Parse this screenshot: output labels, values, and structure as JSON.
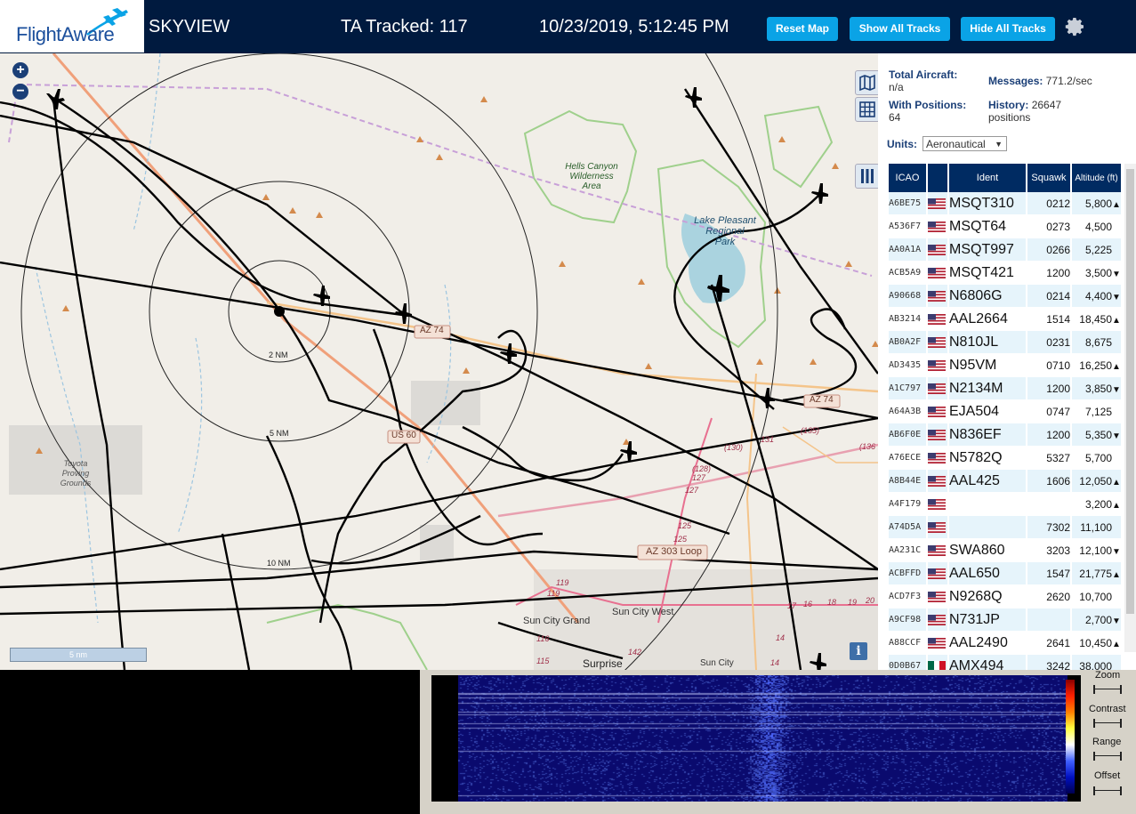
{
  "header": {
    "logo_text": "FlightAware",
    "app_name": "SKYVIEW",
    "tracked": "TA Tracked: 117",
    "datetime": "10/23/2019, 5:12:45 PM",
    "btn_reset": "Reset Map",
    "btn_show": "Show All Tracks",
    "btn_hide": "Hide All Tracks",
    "gear_icon": "gear-icon"
  },
  "map": {
    "zoom_in": "+",
    "zoom_out": "−",
    "labels": {
      "hells": [
        "Hells Canyon",
        "Wilderness",
        "Area"
      ],
      "lake": [
        "Lake Pleasant",
        "Regional",
        "Park"
      ],
      "toyota": [
        "Toyota",
        "Proving",
        "Grounds"
      ],
      "az74": "AZ 74",
      "az74b": "AZ 74",
      "us60": "US 60",
      "az303": "AZ 303 Loop",
      "suncitygrand": "Sun City Grand",
      "suncitywest": "Sun City West",
      "surprise": "Surprise",
      "suncity": "Sun City",
      "r2": "2 NM",
      "r5": "5 NM",
      "r10": "10 NM",
      "n131": "131",
      "n135": "(135)",
      "n130": "(130)",
      "n128": "(128)",
      "n127a": "127",
      "n127b": "127",
      "n136": "(136",
      "n125a": "125",
      "n125b": "125",
      "n119a": "119",
      "n119b": "119",
      "n116": "116",
      "n115": "115",
      "n142": "142",
      "n14a": "14",
      "n14b": "14",
      "n17": "17",
      "n16": "16",
      "n18": "18",
      "n19": "19",
      "n20": "20"
    },
    "scale": "5 nm",
    "info": "i"
  },
  "panel": {
    "total_label": "Total Aircraft:",
    "total_value": "n/a",
    "positions_label": "With Positions:",
    "positions_value": "64",
    "messages_label": "Messages:",
    "messages_value": "771.2/sec",
    "history_label": "History:",
    "history_value": "26647",
    "history_unit": "positions",
    "units_label": "Units:",
    "units_value": "Aeronautical",
    "columns": [
      "ICAO",
      "",
      "Ident",
      "Squawk",
      "Altitude (ft)"
    ]
  },
  "aircraft": [
    {
      "icao": "A6BE75",
      "flag": "us",
      "ident": "MSQT310",
      "squawk": "0212",
      "alt": "5,800",
      "trend": "▲"
    },
    {
      "icao": "A536F7",
      "flag": "us",
      "ident": "MSQT64",
      "squawk": "0273",
      "alt": "4,500",
      "trend": ""
    },
    {
      "icao": "AA0A1A",
      "flag": "us",
      "ident": "MSQT997",
      "squawk": "0266",
      "alt": "5,225",
      "trend": ""
    },
    {
      "icao": "ACB5A9",
      "flag": "us",
      "ident": "MSQT421",
      "squawk": "1200",
      "alt": "3,500",
      "trend": "▼"
    },
    {
      "icao": "A90668",
      "flag": "us",
      "ident": "N6806G",
      "squawk": "0214",
      "alt": "4,400",
      "trend": "▼"
    },
    {
      "icao": "AB3214",
      "flag": "us",
      "ident": "AAL2664",
      "squawk": "1514",
      "alt": "18,450",
      "trend": "▲"
    },
    {
      "icao": "AB0A2F",
      "flag": "us",
      "ident": "N810JL",
      "squawk": "0231",
      "alt": "8,675",
      "trend": ""
    },
    {
      "icao": "AD3435",
      "flag": "us",
      "ident": "N95VM",
      "squawk": "0710",
      "alt": "16,250",
      "trend": "▲"
    },
    {
      "icao": "A1C797",
      "flag": "us",
      "ident": "N2134M",
      "squawk": "1200",
      "alt": "3,850",
      "trend": "▼"
    },
    {
      "icao": "A64A3B",
      "flag": "us",
      "ident": "EJA504",
      "squawk": "0747",
      "alt": "7,125",
      "trend": ""
    },
    {
      "icao": "AB6F0E",
      "flag": "us",
      "ident": "N836EF",
      "squawk": "1200",
      "alt": "5,350",
      "trend": "▼"
    },
    {
      "icao": "A76ECE",
      "flag": "us",
      "ident": "N5782Q",
      "squawk": "5327",
      "alt": "5,700",
      "trend": ""
    },
    {
      "icao": "A8B44E",
      "flag": "us",
      "ident": "AAL425",
      "squawk": "1606",
      "alt": "12,050",
      "trend": "▲"
    },
    {
      "icao": "A4F179",
      "flag": "us",
      "ident": "",
      "squawk": "",
      "alt": "3,200",
      "trend": "▲"
    },
    {
      "icao": "A74D5A",
      "flag": "us",
      "ident": "",
      "squawk": "7302",
      "alt": "11,100",
      "trend": ""
    },
    {
      "icao": "AA231C",
      "flag": "us",
      "ident": "SWA860",
      "squawk": "3203",
      "alt": "12,100",
      "trend": "▼"
    },
    {
      "icao": "ACBFFD",
      "flag": "us",
      "ident": "AAL650",
      "squawk": "1547",
      "alt": "21,775",
      "trend": "▲"
    },
    {
      "icao": "ACD7F3",
      "flag": "us",
      "ident": "N9268Q",
      "squawk": "2620",
      "alt": "10,700",
      "trend": ""
    },
    {
      "icao": "A9CF98",
      "flag": "us",
      "ident": "N731JP",
      "squawk": "",
      "alt": "2,700",
      "trend": "▼"
    },
    {
      "icao": "A88CCF",
      "flag": "us",
      "ident": "AAL2490",
      "squawk": "2641",
      "alt": "10,450",
      "trend": "▲"
    },
    {
      "icao": "0D0B67",
      "flag": "mx",
      "ident": "AMX494",
      "squawk": "3242",
      "alt": "38,000",
      "trend": ""
    }
  ],
  "waterfall": {
    "zoom": "Zoom",
    "contrast": "Contrast",
    "range": "Range",
    "offset": "Offset"
  }
}
